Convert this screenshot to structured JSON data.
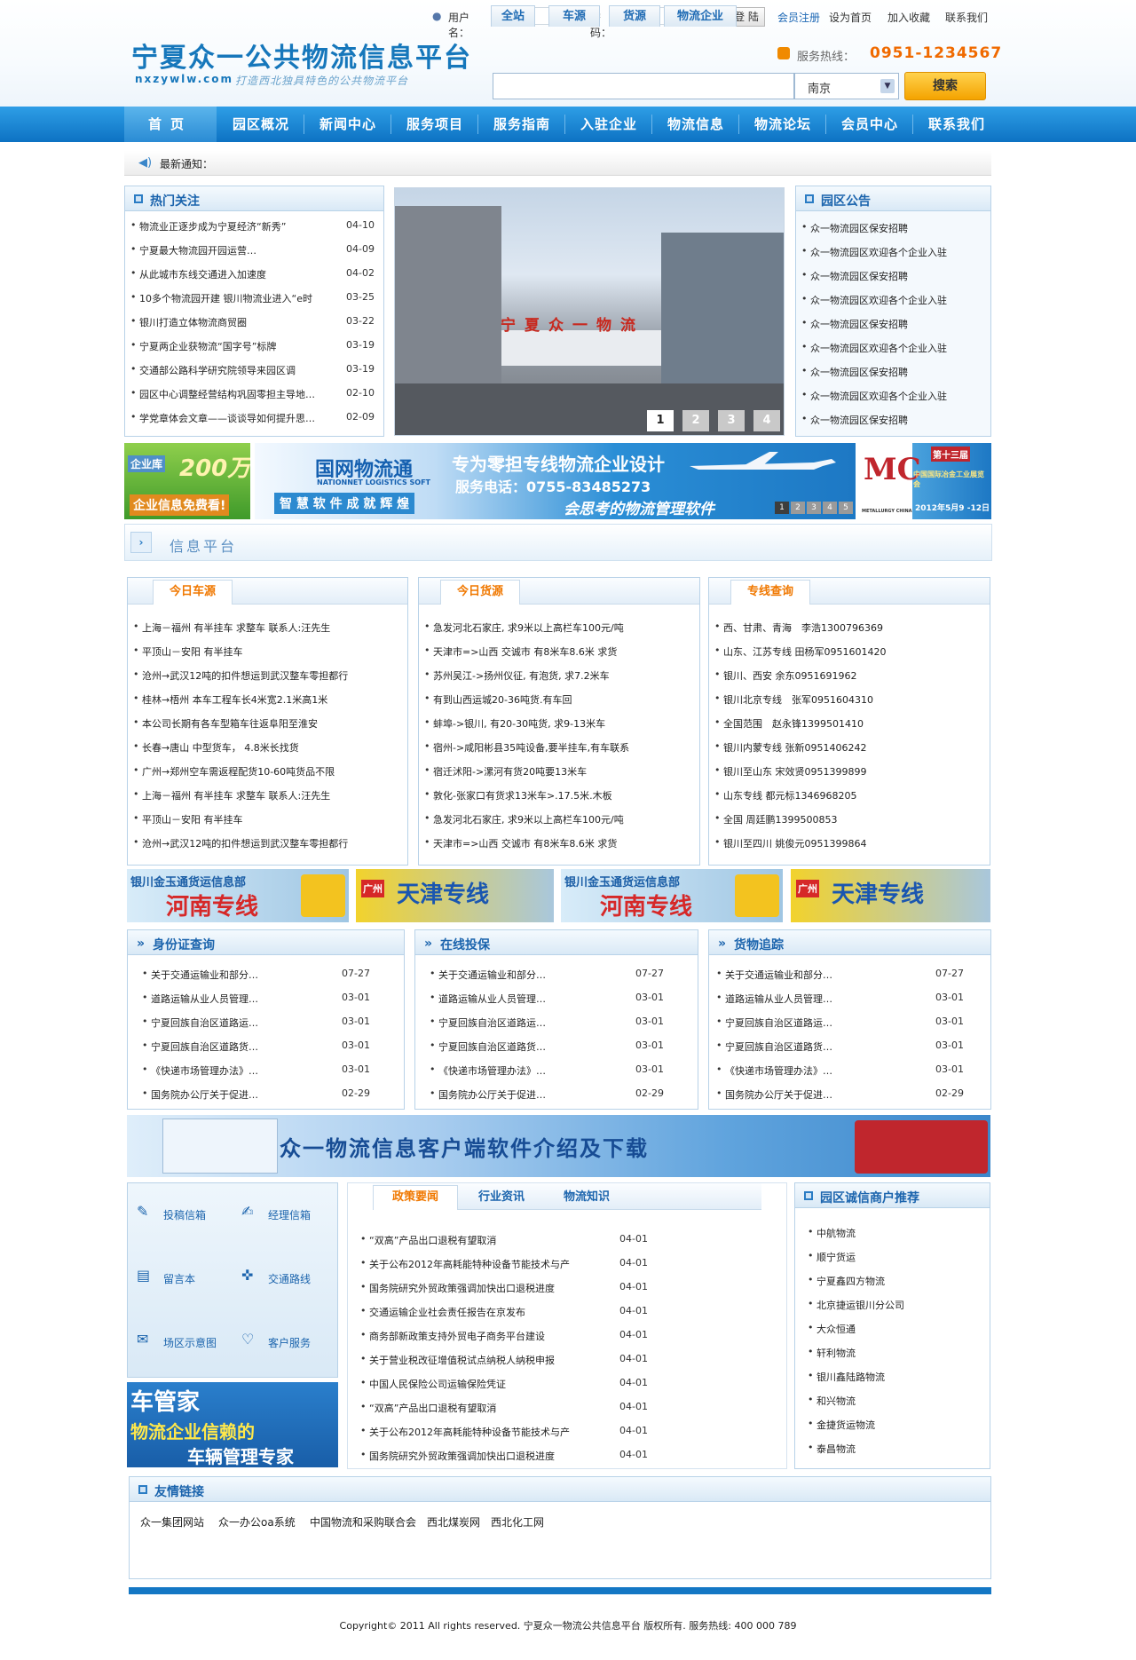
{
  "header": {
    "title": "宁夏众一公共物流信息平台",
    "domain": "nxzywlw.com",
    "slogan": "打造西北独具特色的公共物流平台",
    "login": {
      "username_label": "用户名：",
      "password_label": "密  码：",
      "submit": "登 陆"
    },
    "links": {
      "register": "会员注册",
      "homepage": "设为首页",
      "favorite": "加入收藏",
      "contact": "联系我们"
    },
    "hotline_label": "服务热线：",
    "hotline": "0951-1234567",
    "search_tabs": [
      "全站",
      "车源",
      "货源",
      "物流企业"
    ],
    "search_select": "南京",
    "search_button": "搜索"
  },
  "nav": [
    "首页",
    "园区概况",
    "新闻中心",
    "服务项目",
    "服务指南",
    "入驻企业",
    "物流信息",
    "物流论坛",
    "会员中心",
    "联系我们"
  ],
  "notice_label": "最新通知：",
  "hot": {
    "title": "热门关注",
    "items": [
      {
        "text": "物流业正逐步成为宁夏经济“新秀”",
        "date": "04-10"
      },
      {
        "text": "宁夏最大物流园开园运营…",
        "date": "04-09"
      },
      {
        "text": "从此城市东线交通进入加速度",
        "date": "04-02"
      },
      {
        "text": "10多个物流园开建 银川物流业进入“e时",
        "date": "03-25"
      },
      {
        "text": "银川打造立体物流商贸圈",
        "date": "03-22"
      },
      {
        "text": "宁夏两企业获物流“国字号”标牌",
        "date": "03-19"
      },
      {
        "text": "交通部公路科学研究院领导来园区调",
        "date": "03-19"
      },
      {
        "text": "园区中心调整经营结构巩固零担主导地…",
        "date": "02-10"
      },
      {
        "text": "学党章体会文章——谈谈导如何提升思…",
        "date": "02-09"
      }
    ]
  },
  "slideshow": {
    "sign": "宁夏众一物流",
    "pages": [
      "1",
      "2",
      "3",
      "4"
    ]
  },
  "park_notice": {
    "title": "园区公告",
    "items": [
      "众一物流园区保安招聘",
      "众一物流园区欢迎各个企业入驻",
      "众一物流园区保安招聘",
      "众一物流园区欢迎各个企业入驻",
      "众一物流园区保安招聘",
      "众一物流园区欢迎各个企业入驻",
      "众一物流园区保安招聘",
      "众一物流园区欢迎各个企业入驻",
      "众一物流园区保安招聘"
    ]
  },
  "banners": {
    "left": {
      "line1": "企业库",
      "line2": "200万",
      "line3": "企业信息免费看!"
    },
    "mid": {
      "brand": "国网物流通",
      "brand_en": "NATIONNET LOGISTICS SOFT",
      "slogan1": "专为零担专线物流企业设计",
      "phone": "服务电话：0755-83485273",
      "slogan2": "智 慧 软 件   成 就 辉 煌",
      "slogan3": "会思考的物流管理软件",
      "pages": [
        "1",
        "2",
        "3",
        "4",
        "5"
      ]
    },
    "right": {
      "name": "METALLURGY CHINA",
      "line1": "第十三届",
      "line2": "中国国际冶金工业展览会",
      "date": "2012年5月9 -12日"
    }
  },
  "info_platform": {
    "title": "信息平台"
  },
  "today_vehicles": {
    "tab": "今日车源",
    "items": [
      "上海－福州 有半挂车 求整车 联系人:汪先生",
      "平顶山－安阳 有半挂车",
      "沧州→武汉12吨的扣件想运到武汉整车零担都行",
      "桂林→梧州 本车工程车长4米宽2.1米高1米",
      "本公司长期有各车型箱车往返阜阳至淮安",
      "长春→唐山 中型货车， 4.8米长找货",
      "广州→郑州空车需返程配货10-60吨货品不限",
      "上海－福州 有半挂车 求整车 联系人:汪先生",
      "平顶山－安阳 有半挂车",
      "沧州→武汉12吨的扣件想运到武汉整车零担都行"
    ]
  },
  "today_goods": {
    "tab": "今日货源",
    "items": [
      "急发河北石家庄, 求9米以上高栏车100元/吨",
      "天津市=>山西 交诚市 有8米车8.6米 求货",
      "苏州吴江->扬州仪征, 有泡货, 求7.2米车",
      "有到山西运城20-36吨货.有车回",
      "蚌埠->银川, 有20-30吨货, 求9-13米车",
      "宿州->咸阳彬县35吨设备,要半挂车,有车联系",
      "宿迁沭阳->漯河有货20吨要13米车",
      "敦化-张家口有货求13米车>.17.5米.木板",
      "急发河北石家庄, 求9米以上高栏车100元/吨",
      "天津市=>山西 交诚市 有8米车8.6米 求货"
    ]
  },
  "line_query": {
    "tab": "专线查询",
    "items": [
      "西、甘肃、青海　李浩1300796369",
      "山东、江苏专线 田杨军0951601420",
      "银川、西安 余东0951691962",
      "银川北京专线　张军0951604310",
      "全国范围　赵永锋1399501410",
      "银川内蒙专线 张新0951406242",
      "银川至山东 宋效贤0951399899",
      "山东专线 都元标1346968205",
      "全国 周廷鹏1399500853",
      "银川至四川 姚俊元0951399864"
    ]
  },
  "mid_banners": [
    {
      "top": "银川金玉通货运信息部",
      "main": "河南专线"
    },
    {
      "top": "广州",
      "main": "天津专线"
    },
    {
      "top": "银川金玉通货运信息部",
      "main": "河南专线"
    },
    {
      "top": "广州",
      "main": "天津专线"
    }
  ],
  "id_query": {
    "title": "身份证查询",
    "items": [
      {
        "text": "关于交通运输业和部分…",
        "date": "07-27"
      },
      {
        "text": "道路运输从业人员管理…",
        "date": "03-01"
      },
      {
        "text": "宁夏回族自治区道路运…",
        "date": "03-01"
      },
      {
        "text": "宁夏回族自治区道路货…",
        "date": "03-01"
      },
      {
        "text": "《快递市场管理办法》…",
        "date": "03-01"
      },
      {
        "text": "国务院办公厅关于促进…",
        "date": "02-29"
      }
    ]
  },
  "online_complaint": {
    "title": "在线投保",
    "items": [
      {
        "text": "关于交通运输业和部分…",
        "date": "07-27"
      },
      {
        "text": "道路运输从业人员管理…",
        "date": "03-01"
      },
      {
        "text": "宁夏回族自治区道路运…",
        "date": "03-01"
      },
      {
        "text": "宁夏回族自治区道路货…",
        "date": "03-01"
      },
      {
        "text": "《快递市场管理办法》…",
        "date": "03-01"
      },
      {
        "text": "国务院办公厅关于促进…",
        "date": "02-29"
      }
    ]
  },
  "cargo_track": {
    "title": "货物追踪",
    "items": [
      {
        "text": "关于交通运输业和部分…",
        "date": "07-27"
      },
      {
        "text": "道路运输从业人员管理…",
        "date": "03-01"
      },
      {
        "text": "宁夏回族自治区道路运…",
        "date": "03-01"
      },
      {
        "text": "宁夏回族自治区道路货…",
        "date": "03-01"
      },
      {
        "text": "《快递市场管理办法》…",
        "date": "03-01"
      },
      {
        "text": "国务院办公厅关于促进…",
        "date": "02-29"
      }
    ]
  },
  "client_banner": {
    "title": "众一物流信息客户端软件介绍及下载"
  },
  "left_menu": [
    "投稿信箱",
    "经理信箱",
    "留言本",
    "交通路线",
    "场区示意图",
    "客户服务"
  ],
  "car_banner": {
    "line1": "车管家",
    "line2": "物流企业信赖的",
    "line3": "车辆管理专家"
  },
  "policy": {
    "tabs": [
      "政策要闻",
      "行业资讯",
      "物流知识"
    ],
    "items": [
      {
        "text": "“双高”产品出口退税有望取消",
        "date": "04-01"
      },
      {
        "text": "关于公布2012年高耗能特种设备节能技术与产",
        "date": "04-01"
      },
      {
        "text": "国务院研究外贸政策强调加快出口退税进度",
        "date": "04-01"
      },
      {
        "text": "交通运输企业社会责任报告在京发布",
        "date": "04-01"
      },
      {
        "text": "商务部新政策支持外贸电子商务平台建设",
        "date": "04-01"
      },
      {
        "text": "关于营业税改征增值税试点纳税人纳税申报",
        "date": "04-01"
      },
      {
        "text": "中国人民保险公司运输保险凭证",
        "date": "04-01"
      },
      {
        "text": "“双高”产品出口退税有望取消",
        "date": "04-01"
      },
      {
        "text": "关于公布2012年高耗能特种设备节能技术与产",
        "date": "04-01"
      },
      {
        "text": "国务院研究外贸政策强调加快出口退税进度",
        "date": "04-01"
      }
    ]
  },
  "merchants": {
    "title": "园区诚信商户推荐",
    "items": [
      "中航物流",
      "顺宁货运",
      "宁夏鑫四方物流",
      "北京捷运银川分公司",
      "大众恒通",
      "轩利物流",
      "银川鑫陆路物流",
      "和兴物流",
      "金捷货运物流",
      "泰昌物流"
    ]
  },
  "friend_links": {
    "title": "友情链接",
    "items": [
      "众一集团网站",
      "众一办公oa系统",
      "中国物流和采购联合会",
      "西北煤炭网",
      "西北化工网"
    ]
  },
  "footer": "Copyright© 2011 All rights reserved. 宁夏众一物流公共信息平台 版权所有.   服务热线: 400 000 789"
}
